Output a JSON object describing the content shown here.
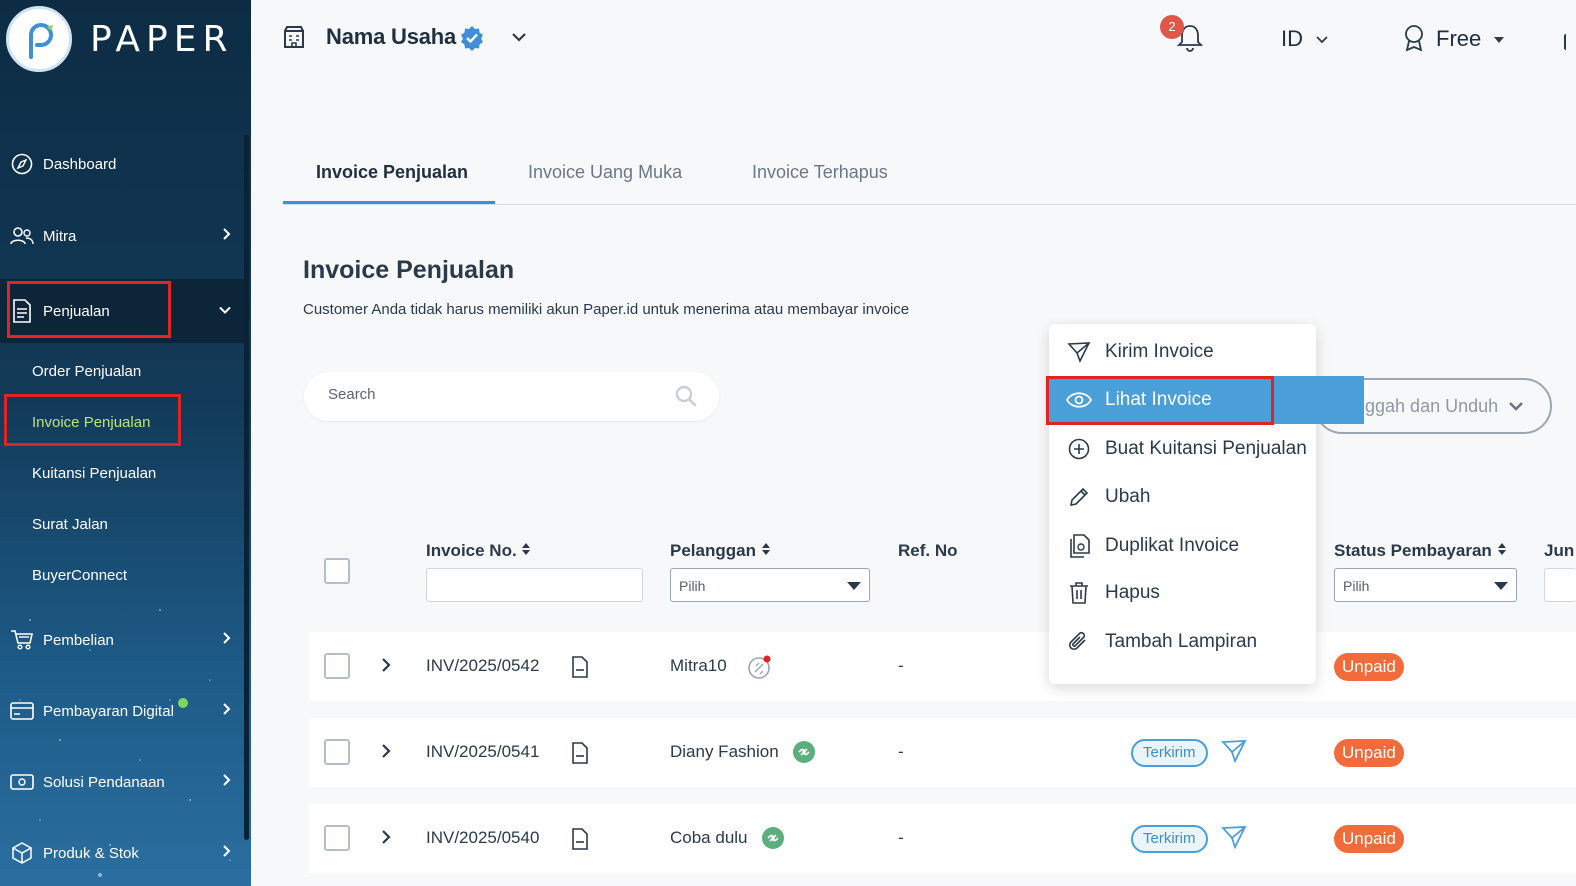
{
  "brand": {
    "name": "PAPER"
  },
  "sidebar": {
    "items": [
      {
        "label": "Dashboard"
      },
      {
        "label": "Mitra"
      },
      {
        "label": "Penjualan"
      },
      {
        "label": "Pembelian"
      },
      {
        "label": "Pembayaran Digital"
      },
      {
        "label": "Solusi Pendanaan"
      },
      {
        "label": "Produk & Stok"
      }
    ],
    "sub_items": [
      {
        "label": "Order Penjualan"
      },
      {
        "label": "Invoice Penjualan"
      },
      {
        "label": "Kuitansi Penjualan"
      },
      {
        "label": "Surat Jalan"
      },
      {
        "label": "BuyerConnect"
      }
    ]
  },
  "header": {
    "business_name": "Nama Usaha",
    "notification_count": "2",
    "language": "ID",
    "plan": "Free"
  },
  "tabs": [
    {
      "label": "Invoice Penjualan"
    },
    {
      "label": "Invoice Uang Muka"
    },
    {
      "label": "Invoice Terhapus"
    }
  ],
  "page": {
    "title": "Invoice Penjualan",
    "subtitle": "Customer Anda tidak harus memiliki akun Paper.id untuk menerima atau membayar invoice",
    "search_placeholder": "Search",
    "upload_download_label": "Unggah dan Unduh"
  },
  "table": {
    "headers": {
      "invoice_no": "Invoice No.",
      "pelanggan": "Pelanggan",
      "ref_no": "Ref. No",
      "status_pembayaran": "Status Pembayaran",
      "jumlah": "Jun"
    },
    "filter_placeholder": "Pilih",
    "rows": [
      {
        "invoice_no": "INV/2025/0542",
        "customer": "Mitra10",
        "ref_no": "-",
        "sent_status": "",
        "payment_status": "Unpaid"
      },
      {
        "invoice_no": "INV/2025/0541",
        "customer": "Diany Fashion",
        "ref_no": "-",
        "sent_status": "Terkirim",
        "payment_status": "Unpaid"
      },
      {
        "invoice_no": "INV/2025/0540",
        "customer": "Coba dulu",
        "ref_no": "-",
        "sent_status": "Terkirim",
        "payment_status": "Unpaid"
      }
    ]
  },
  "action_menu": {
    "items": [
      {
        "label": "Kirim Invoice",
        "icon": "send-icon"
      },
      {
        "label": "Lihat Invoice",
        "icon": "eye-icon"
      },
      {
        "label": "Buat Kuitansi Penjualan",
        "icon": "plus-circle-icon"
      },
      {
        "label": "Ubah",
        "icon": "pencil-icon"
      },
      {
        "label": "Duplikat Invoice",
        "icon": "duplicate-icon"
      },
      {
        "label": "Hapus",
        "icon": "trash-icon"
      },
      {
        "label": "Tambah Lampiran",
        "icon": "paperclip-icon"
      }
    ],
    "highlighted": "Lihat Invoice"
  },
  "colors": {
    "accent": "#4a9fd8",
    "unpaid": "#f26b3a",
    "highlight_box": "#e02424",
    "active_sub": "#b9e37a"
  }
}
